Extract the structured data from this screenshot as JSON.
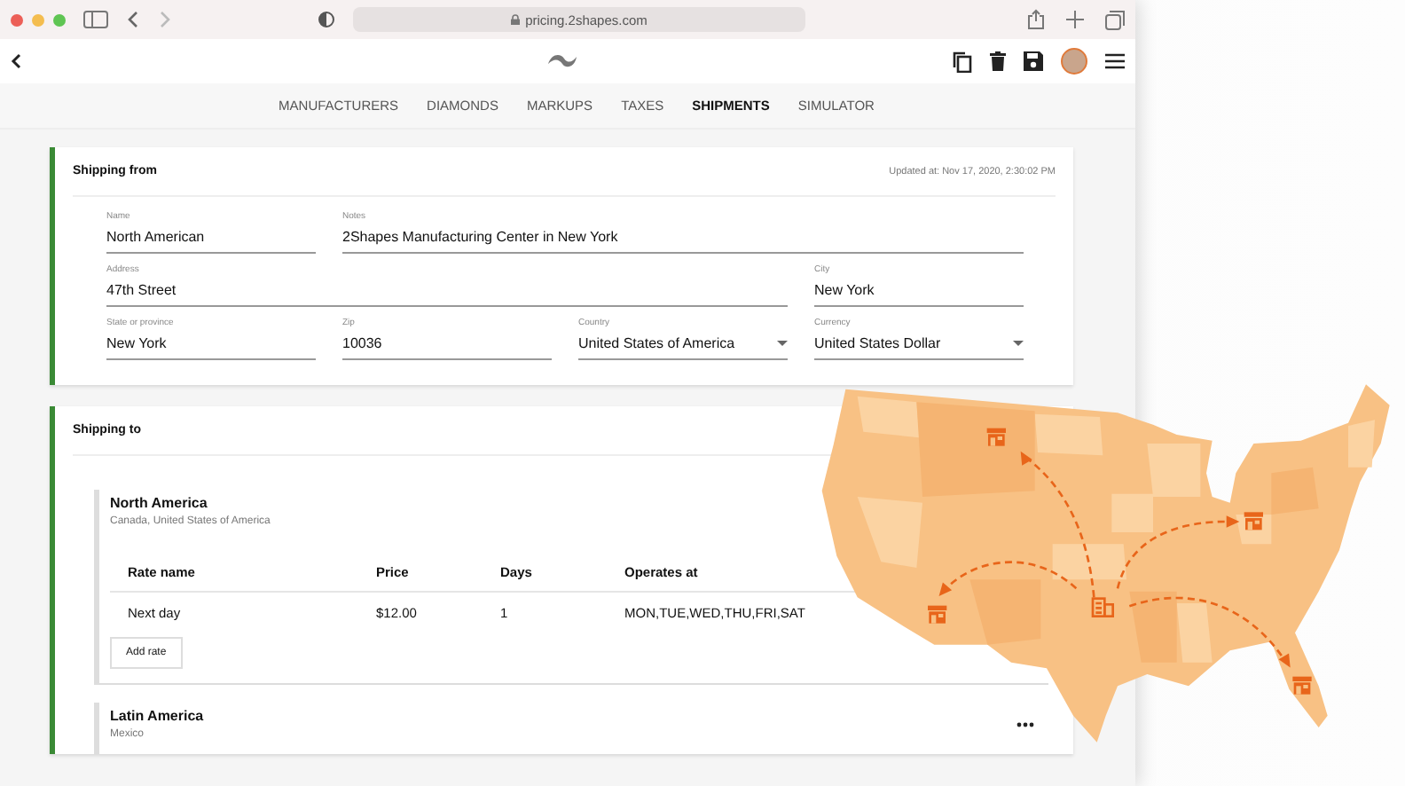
{
  "browser": {
    "address": "pricing.2shapes.com"
  },
  "nav": [
    {
      "label": "MANUFACTURERS",
      "selected": false
    },
    {
      "label": "DIAMONDS",
      "selected": false
    },
    {
      "label": "MARKUPS",
      "selected": false
    },
    {
      "label": "TAXES",
      "selected": false
    },
    {
      "label": "SHIPMENTS",
      "selected": true
    },
    {
      "label": "SIMULATOR",
      "selected": false
    }
  ],
  "shipping_from": {
    "title": "Shipping from",
    "updated": "Updated at: Nov 17, 2020, 2:30:02 PM",
    "fields": [
      {
        "label": "Name",
        "value": "North American",
        "kind": "text"
      },
      {
        "label": "Notes",
        "value": "2Shapes Manufacturing Center in New York",
        "kind": "text"
      },
      {
        "label": "Address",
        "value": "47th Street",
        "kind": "text"
      },
      {
        "label": "City",
        "value": "New York",
        "kind": "text"
      },
      {
        "label": "State or province",
        "value": "New York",
        "kind": "text"
      },
      {
        "label": "Zip",
        "value": "10036",
        "kind": "text"
      },
      {
        "label": "Country",
        "value": "United States of America",
        "kind": "select"
      },
      {
        "label": "Currency",
        "value": "United States Dollar",
        "kind": "select"
      }
    ]
  },
  "shipping_to": {
    "title": "Shipping to",
    "regions": [
      {
        "name": "North America",
        "countries": "Canada, United States of America",
        "columns": [
          "Rate name",
          "Price",
          "Days",
          "Operates at"
        ],
        "rows": [
          [
            "Next day",
            "$12.00",
            "1",
            "MON,TUE,WED,THU,FRI,SAT"
          ]
        ],
        "add_button": "Add rate"
      },
      {
        "name": "Latin America",
        "countries": "Mexico"
      }
    ]
  }
}
